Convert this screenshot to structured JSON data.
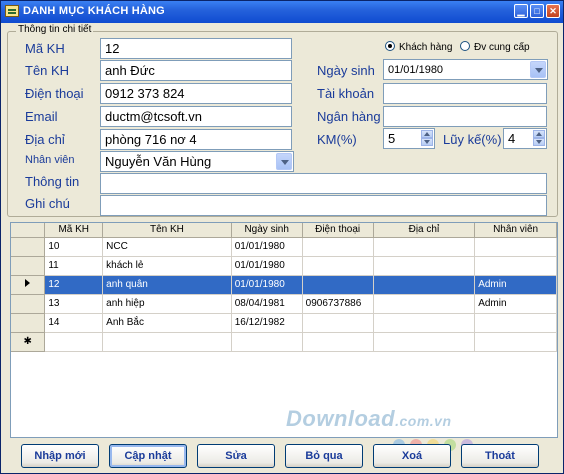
{
  "window": {
    "title": "DANH MỤC KHÁCH HÀNG",
    "min_glyph": "▁",
    "max_glyph": "□",
    "close_glyph": "✕"
  },
  "details": {
    "legend": "Thông tin chi tiết",
    "radio_customer": "Khách hàng",
    "radio_supplier": "Đv cung cấp",
    "selected_radio": "Khách hàng",
    "ma_kh_label": "Mã KH",
    "ma_kh_value": "12",
    "ten_kh_label": "Tên KH",
    "ten_kh_value": "anh Đức",
    "dien_thoai_label": "Điện thoại",
    "dien_thoai_value": "0912 373 824",
    "email_label": "Email",
    "email_value": "ductm@tcsoft.vn",
    "dia_chi_label": "Địa chỉ",
    "dia_chi_value": "phòng 716 nơ 4",
    "nhan_vien_label": "Nhân viên",
    "nhan_vien_value": "Nguyễn Văn Hùng",
    "thong_tin_label": "Thông tin",
    "thong_tin_value": "",
    "ghi_chu_label": "Ghi chú",
    "ghi_chu_value": "",
    "ngay_sinh_label": "Ngày sinh",
    "ngay_sinh_value": "01/01/1980",
    "tai_khoan_label": "Tài khoản",
    "tai_khoan_value": "",
    "ngan_hang_label": "Ngân hàng",
    "ngan_hang_value": "",
    "km_label": "KM(%)",
    "km_value": "5",
    "luy_ke_label": "Lũy kế(%)",
    "luy_ke_value": "4"
  },
  "grid": {
    "columns": [
      "Mã KH",
      "Tên KH",
      "Ngày sinh",
      "Điện thoại",
      "Địa chỉ",
      "Nhân viên"
    ],
    "rows": [
      {
        "ma": "10",
        "ten": "NCC",
        "ngay_sinh": "01/01/1980",
        "dien_thoai": "",
        "dia_chi": "",
        "nhan_vien": ""
      },
      {
        "ma": "11",
        "ten": "khách lẻ",
        "ngay_sinh": "01/01/1980",
        "dien_thoai": "",
        "dia_chi": "",
        "nhan_vien": ""
      },
      {
        "ma": "12",
        "ten": "anh quân",
        "ngay_sinh": "01/01/1980",
        "dien_thoai": "",
        "dia_chi": "",
        "nhan_vien": "Admin"
      },
      {
        "ma": "13",
        "ten": "anh hiệp",
        "ngay_sinh": "08/04/1981",
        "dien_thoai": "0906737886",
        "dia_chi": "",
        "nhan_vien": "Admin"
      },
      {
        "ma": "14",
        "ten": "Anh Bắc",
        "ngay_sinh": "16/12/1982",
        "dien_thoai": "",
        "dia_chi": "",
        "nhan_vien": ""
      }
    ],
    "selected_row": 3,
    "new_row_marker": "✱"
  },
  "watermark": {
    "main": "Download",
    "suffix": ".com.vn"
  },
  "buttons": {
    "nhap_moi": "Nhập mới",
    "cap_nhat": "Cập nhật",
    "sua": "Sửa",
    "bo_qua": "Bỏ qua",
    "xoa": "Xoá",
    "thoat": "Thoát"
  },
  "colors": {
    "titlebar": "#2562DC",
    "selection": "#316AC5",
    "label": "#1A3B9A",
    "window_bg": "#ECE9D8"
  },
  "icons": {
    "app": "app-icon",
    "dropdown": "chevron-down-icon",
    "spinner": "spinner-icon",
    "row_pointer": "row-pointer-icon"
  }
}
